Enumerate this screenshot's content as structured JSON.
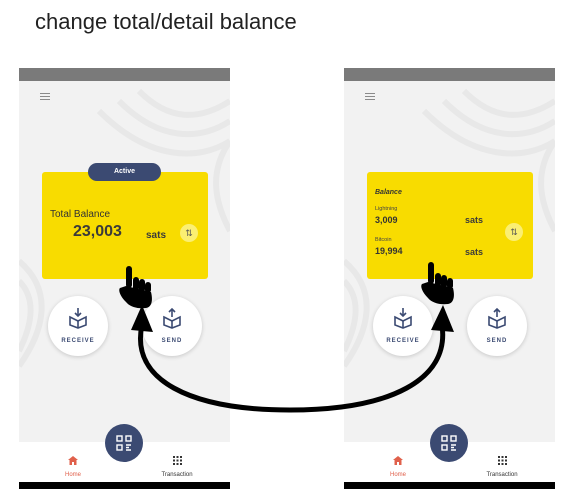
{
  "header": {
    "title": "change total/detail balance"
  },
  "left_screen": {
    "badge": "Active",
    "total_label": "Total Balance",
    "total_value": "23,003",
    "unit": "sats",
    "receive_label": "RECEIVE",
    "send_label": "SEND",
    "nav_home": "Home",
    "nav_transaction": "Transaction"
  },
  "right_screen": {
    "heading": "Balance",
    "lightning_label": "Lightning",
    "lightning_value": "3,009",
    "lightning_unit": "sats",
    "bitcoin_label": "Bitcoin",
    "bitcoin_value": "19,994",
    "bitcoin_unit": "sats",
    "receive_label": "RECEIVE",
    "send_label": "SEND",
    "nav_home": "Home",
    "nav_transaction": "Transaction"
  },
  "colors": {
    "card": "#f8dc00",
    "accent": "#3b4a72",
    "home_active": "#e0604b"
  },
  "icons": [
    "menu-icon",
    "swap-icon",
    "receive-icon",
    "send-icon",
    "home-icon",
    "grid-icon",
    "qr-icon",
    "pointer-hand-icon"
  ]
}
